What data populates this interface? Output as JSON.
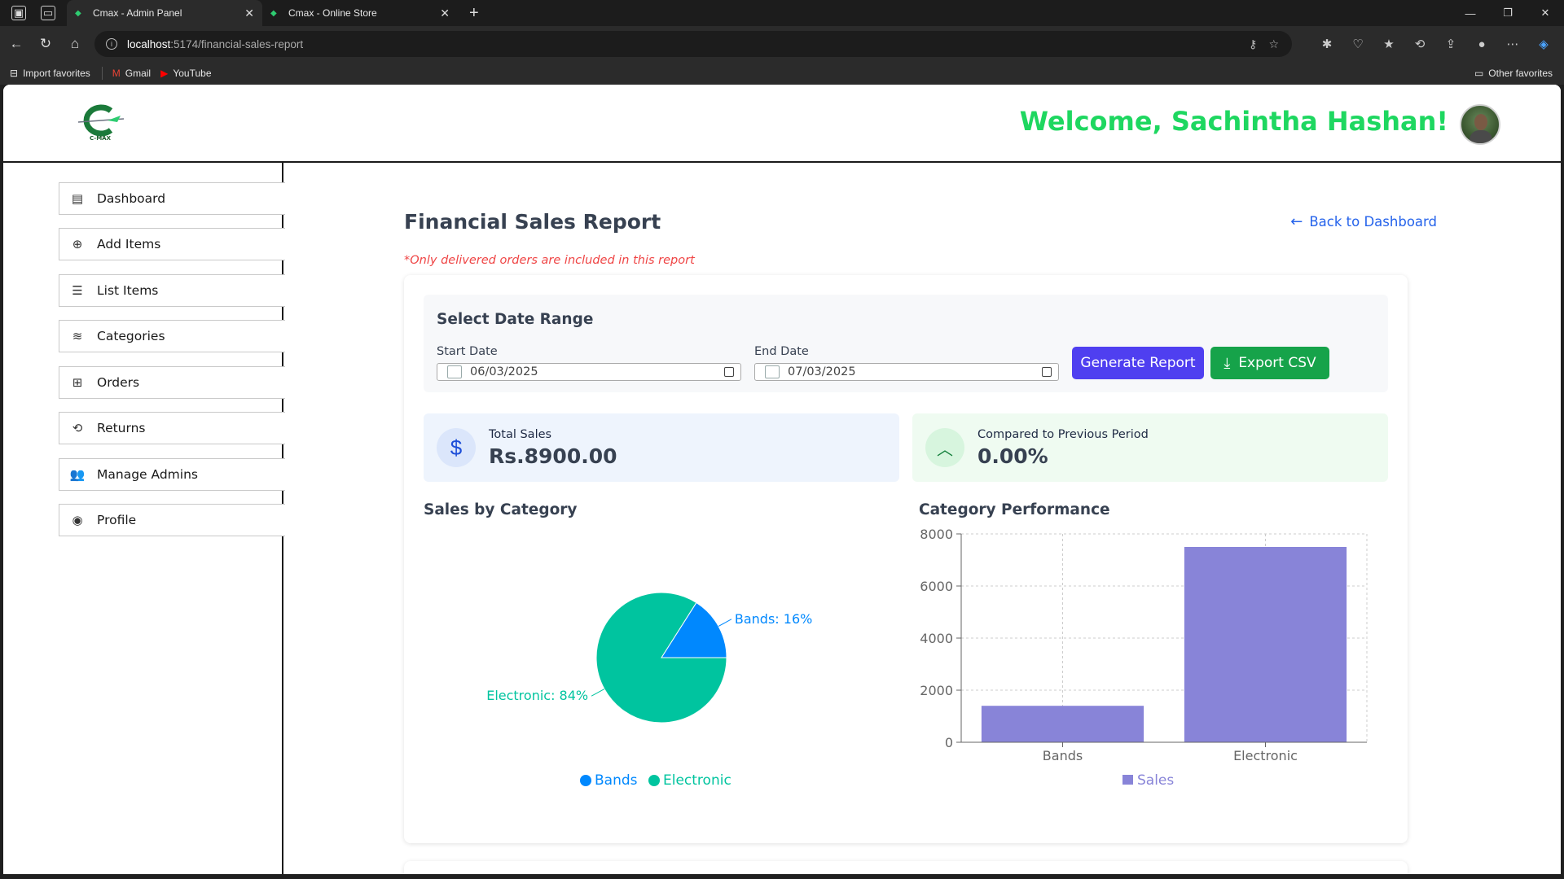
{
  "browser": {
    "tabs": [
      {
        "title": "Cmax - Admin Panel",
        "active": true
      },
      {
        "title": "Cmax - Online Store",
        "active": false
      }
    ],
    "url_host": "localhost",
    "url_path": ":5174/financial-sales-report",
    "favorites": [
      {
        "label": "Import favorites",
        "icon": "import-icon"
      },
      {
        "label": "Gmail",
        "icon": "gmail-icon"
      },
      {
        "label": "YouTube",
        "icon": "youtube-icon"
      }
    ],
    "other_favorites": "Other favorites"
  },
  "header": {
    "logo_text": "C-MAX",
    "welcome": "Welcome, Sachintha Hashan!"
  },
  "sidebar": {
    "items": [
      {
        "label": "Dashboard",
        "icon": "dashboard-icon"
      },
      {
        "label": "Add Items",
        "icon": "add-items-icon"
      },
      {
        "label": "List Items",
        "icon": "list-icon"
      },
      {
        "label": "Categories",
        "icon": "layers-icon"
      },
      {
        "label": "Orders",
        "icon": "orders-icon"
      },
      {
        "label": "Returns",
        "icon": "returns-icon"
      },
      {
        "label": "Manage Admins",
        "icon": "users-icon"
      },
      {
        "label": "Profile",
        "icon": "profile-icon"
      }
    ]
  },
  "page": {
    "title": "Financial Sales Report",
    "back_label": "Back to Dashboard",
    "note": "*Only delivered orders are included in this report"
  },
  "date_range": {
    "title": "Select Date Range",
    "start_label": "Start Date",
    "start_value": "06/03/2025",
    "end_label": "End Date",
    "end_value": "07/03/2025",
    "generate_label": "Generate Report",
    "export_label": "Export CSV"
  },
  "stats": {
    "total_label": "Total Sales",
    "total_value": "Rs.8900.00",
    "compare_label": "Compared to Previous Period",
    "compare_value": "0.00%"
  },
  "colors": {
    "accent_green": "#1ed760",
    "bands": "#0088fe",
    "electronic": "#00c49f",
    "bar": "#8884d8"
  },
  "chart_data": [
    {
      "type": "pie",
      "title": "Sales by Category",
      "categories": [
        "Bands",
        "Electronic"
      ],
      "values": [
        16,
        84
      ],
      "labels": [
        "Bands: 16%",
        "Electronic: 84%"
      ],
      "legend": [
        "Bands",
        "Electronic"
      ],
      "legend_position": "bottom"
    },
    {
      "type": "bar",
      "title": "Category Performance",
      "categories": [
        "Bands",
        "Electronic"
      ],
      "series": [
        {
          "name": "Sales",
          "values": [
            1400,
            7500
          ]
        }
      ],
      "yticks": [
        "0",
        "2000",
        "4000",
        "6000",
        "8000"
      ],
      "ylim": [
        0,
        8000
      ],
      "grid": true,
      "legend_position": "bottom"
    }
  ]
}
